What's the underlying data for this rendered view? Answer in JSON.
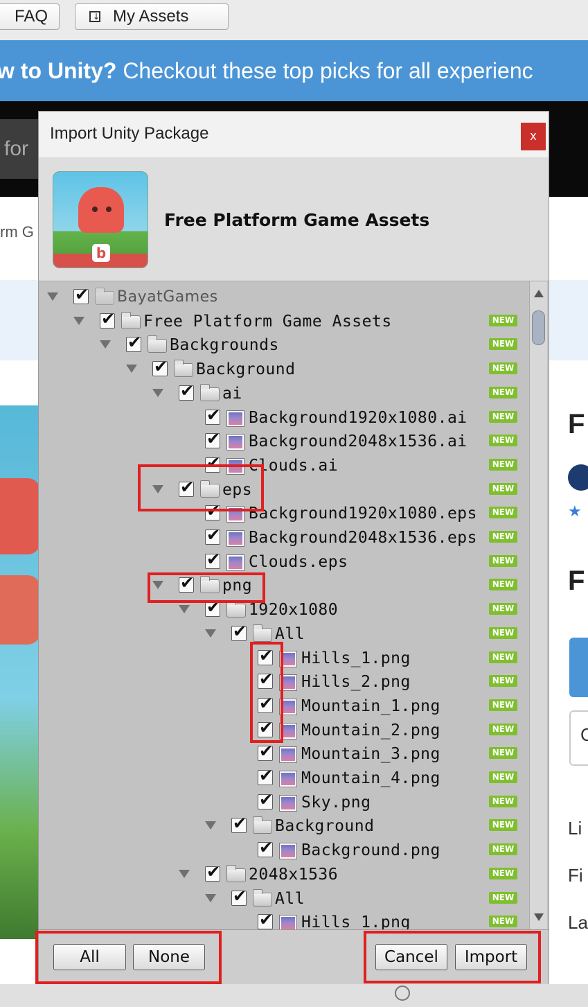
{
  "topbar": {
    "faq": "FAQ",
    "my_assets": "My Assets",
    "my_assets_icon": "download-box-icon"
  },
  "banner": {
    "bold": "w to Unity?",
    "rest": " Checkout these top picks for all experienc"
  },
  "search_fragment": "for",
  "breadcrumb_fragment": "rm G",
  "right_fragments": {
    "f1": "F",
    "f2": "F",
    "li": "Li",
    "fi": "Fi",
    "la": "La",
    "c": "C"
  },
  "dialog": {
    "title": "Import Unity Package",
    "close": "x",
    "package_name": "Free Platform Game Assets",
    "new_badge": "NEW",
    "tree": [
      {
        "label": "BayatGames",
        "depth": 0,
        "type": "folder",
        "arrow": true,
        "dim": true,
        "badge": false
      },
      {
        "label": "Free Platform Game Assets",
        "depth": 1,
        "type": "folder",
        "arrow": true,
        "badge": true
      },
      {
        "label": "Backgrounds",
        "depth": 2,
        "type": "folder",
        "arrow": true,
        "badge": true
      },
      {
        "label": "Background",
        "depth": 3,
        "type": "folder",
        "arrow": true,
        "badge": true
      },
      {
        "label": "ai",
        "depth": 4,
        "type": "folder",
        "arrow": true,
        "badge": true
      },
      {
        "label": "Background1920x1080.ai",
        "depth": 5,
        "type": "image",
        "badge": true
      },
      {
        "label": "Background2048x1536.ai",
        "depth": 5,
        "type": "image",
        "badge": true
      },
      {
        "label": "Clouds.ai",
        "depth": 5,
        "type": "image",
        "badge": true
      },
      {
        "label": "eps",
        "depth": 4,
        "type": "folder",
        "arrow": true,
        "badge": true
      },
      {
        "label": "Background1920x1080.eps",
        "depth": 5,
        "type": "image",
        "badge": true
      },
      {
        "label": "Background2048x1536.eps",
        "depth": 5,
        "type": "image",
        "badge": true
      },
      {
        "label": "Clouds.eps",
        "depth": 5,
        "type": "image",
        "badge": true
      },
      {
        "label": "png",
        "depth": 4,
        "type": "folder",
        "arrow": true,
        "badge": true
      },
      {
        "label": "1920x1080",
        "depth": 5,
        "type": "folder",
        "arrow": true,
        "badge": true
      },
      {
        "label": "All",
        "depth": 6,
        "type": "folder",
        "arrow": true,
        "badge": true
      },
      {
        "label": "Hills_1.png",
        "depth": 7,
        "type": "image",
        "badge": true
      },
      {
        "label": "Hills_2.png",
        "depth": 7,
        "type": "image",
        "badge": true
      },
      {
        "label": "Mountain_1.png",
        "depth": 7,
        "type": "image",
        "badge": true
      },
      {
        "label": "Mountain_2.png",
        "depth": 7,
        "type": "image",
        "badge": true
      },
      {
        "label": "Mountain_3.png",
        "depth": 7,
        "type": "image",
        "badge": true
      },
      {
        "label": "Mountain_4.png",
        "depth": 7,
        "type": "image",
        "badge": true
      },
      {
        "label": "Sky.png",
        "depth": 7,
        "type": "image",
        "badge": true
      },
      {
        "label": "Background",
        "depth": 6,
        "type": "folder",
        "arrow": true,
        "badge": true
      },
      {
        "label": "Background.png",
        "depth": 7,
        "type": "image",
        "badge": true
      },
      {
        "label": "2048x1536",
        "depth": 5,
        "type": "folder",
        "arrow": true,
        "badge": true
      },
      {
        "label": "All",
        "depth": 6,
        "type": "folder",
        "arrow": true,
        "badge": true
      },
      {
        "label": "Hills_1.png",
        "depth": 7,
        "type": "image",
        "badge": true
      }
    ],
    "buttons": {
      "all": "All",
      "none": "None",
      "cancel": "Cancel",
      "import": "Import"
    }
  },
  "colors": {
    "banner": "#4b95d6",
    "close": "#c9302c",
    "new_badge": "#7fbf2e",
    "highlight": "#e02020"
  }
}
